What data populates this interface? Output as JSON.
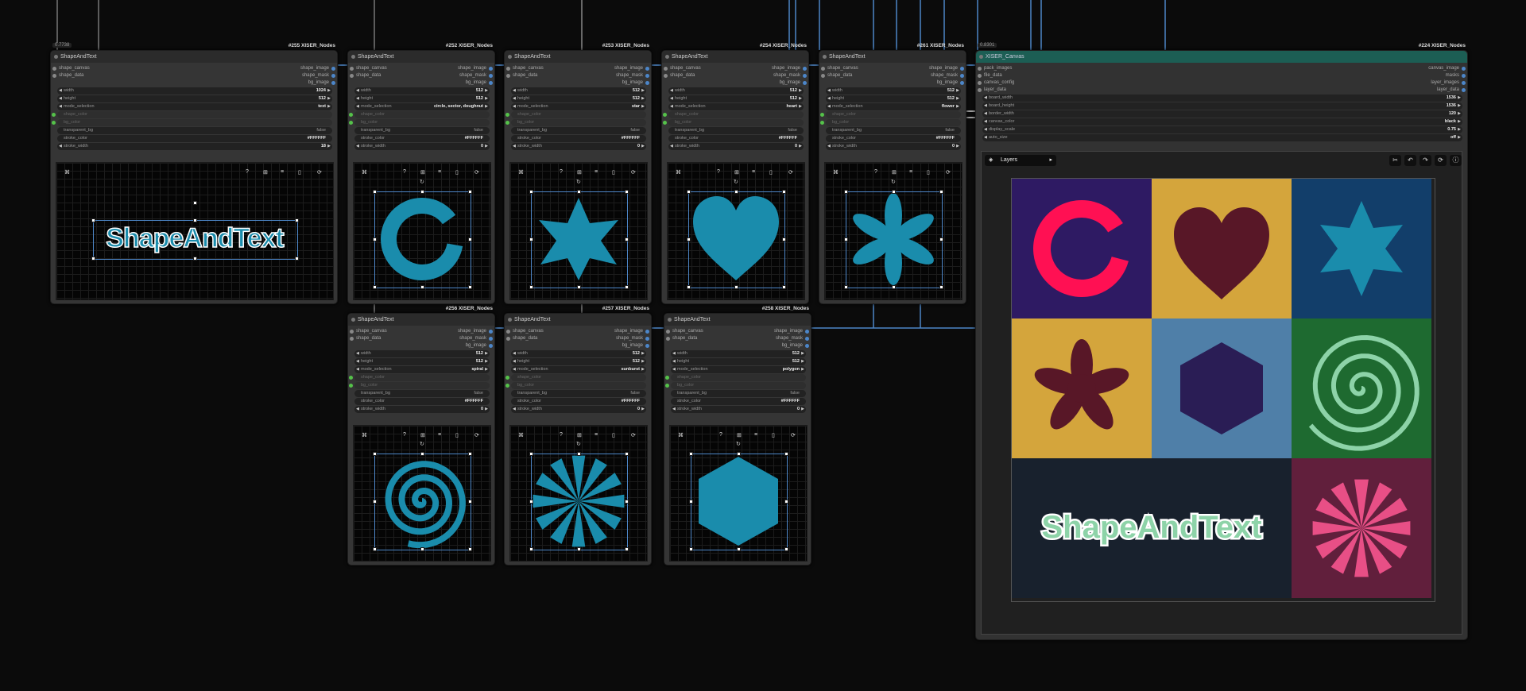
{
  "sat_nodes": [
    {
      "id": "#255 XISER_Nodes",
      "title": "ShapeAndText",
      "tag": "0.7738",
      "mode": "text",
      "width": "1024",
      "height": "512",
      "stroke_width": "18",
      "shape": "text"
    },
    {
      "id": "#252 XISER_Nodes",
      "title": "ShapeAndText",
      "mode": "circle, sector, doughnut",
      "width": "512",
      "height": "512",
      "stroke_width": "0",
      "shape": "ring"
    },
    {
      "id": "#253 XISER_Nodes",
      "title": "ShapeAndText",
      "mode": "star",
      "width": "512",
      "height": "512",
      "stroke_width": "0",
      "shape": "star"
    },
    {
      "id": "#254 XISER_Nodes",
      "title": "ShapeAndText",
      "mode": "heart",
      "width": "512",
      "height": "512",
      "stroke_width": "0",
      "shape": "heart"
    },
    {
      "id": "#261 XISER_Nodes",
      "title": "ShapeAndText",
      "mode": "flower",
      "width": "512",
      "height": "512",
      "stroke_width": "0",
      "shape": "flower"
    },
    {
      "id": "#256 XISER_Nodes",
      "title": "ShapeAndText",
      "mode": "spiral",
      "width": "512",
      "height": "512",
      "stroke_width": "0",
      "shape": "spiral"
    },
    {
      "id": "#257 XISER_Nodes",
      "title": "ShapeAndText",
      "mode": "sunburst",
      "width": "512",
      "height": "512",
      "stroke_width": "0",
      "shape": "sunburst"
    },
    {
      "id": "#258 XISER_Nodes",
      "title": "ShapeAndText",
      "mode": "polygon",
      "width": "512",
      "height": "512",
      "stroke_width": "0",
      "shape": "hexagon"
    }
  ],
  "sat_labels": {
    "in1": "shape_canvas",
    "in2": "shape_data",
    "out1": "shape_image",
    "out2": "shape_mask",
    "out3": "bg_image",
    "width": "width",
    "height": "height",
    "mode": "mode_selection",
    "shape_color": "shape_color",
    "bg_color": "bg_color",
    "transparent_bg": "transparent_bg",
    "transparent_val": "false",
    "stroke_color": "stroke_color",
    "stroke_val": "#FFFFFF",
    "stroke_width": "stroke_width",
    "preview_text": "ShapeAndText",
    "toolbar": [
      "⌘",
      "?",
      "⊞",
      "≡",
      "▯",
      "⟳"
    ]
  },
  "canvas_node": {
    "id": "#224 XISER_Nodes",
    "title": "XISER_Canvas",
    "tag": "0.8301",
    "inputs": [
      "pack_images",
      "file_data",
      "canvas_config",
      "layer_data"
    ],
    "outputs": [
      "canvas_image",
      "masks",
      "layer_images",
      "layer_data"
    ],
    "widgets": [
      {
        "label": "board_width",
        "value": "1536"
      },
      {
        "label": "board_height",
        "value": "1536"
      },
      {
        "label": "border_width",
        "value": "120"
      },
      {
        "label": "canvas_color",
        "value": "black"
      },
      {
        "label": "display_scale",
        "value": "0.75"
      },
      {
        "label": "auto_size",
        "value": "off"
      }
    ],
    "layers_label": "Layers",
    "board_text": "ShapeAndText"
  },
  "colors": {
    "node_bg": "#353535",
    "shape_blue": "#1a8cac",
    "board_purple": "#2e1a63",
    "board_gold": "#d4a53c",
    "board_navy": "#123e6a",
    "board_steel": "#4f7fa8",
    "board_green": "#1e6a30",
    "board_dark": "#18212d",
    "board_wine": "#611f3c",
    "ring": "#ff1053",
    "heart": "#581727",
    "hexagon": "#2a1d55",
    "spiral": "#8dd3a8",
    "sunburst": "#e84f86",
    "canvas_header": "#1c5e54",
    "wire": "#4d86c7"
  }
}
